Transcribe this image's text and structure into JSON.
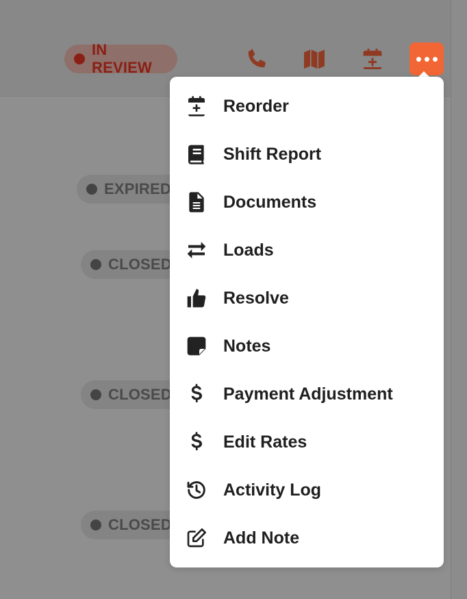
{
  "header": {
    "status_badge": "IN REVIEW",
    "actions": [
      {
        "name": "phone-icon"
      },
      {
        "name": "map-icon"
      },
      {
        "name": "calendar-plus-icon"
      },
      {
        "name": "more-icon"
      }
    ]
  },
  "rows": [
    {
      "status": "EXPIRED"
    },
    {
      "status": "CLOSED"
    },
    {
      "status": "CLOSED"
    },
    {
      "status": "CLOSED"
    }
  ],
  "menu": {
    "items": [
      {
        "label": "Reorder",
        "icon": "calendar-plus-icon"
      },
      {
        "label": "Shift Report",
        "icon": "book-icon"
      },
      {
        "label": "Documents",
        "icon": "file-lines-icon"
      },
      {
        "label": "Loads",
        "icon": "arrows-exchange-icon"
      },
      {
        "label": "Resolve",
        "icon": "thumbs-up-icon"
      },
      {
        "label": "Notes",
        "icon": "sticky-note-icon"
      },
      {
        "label": "Payment Adjustment",
        "icon": "dollar-icon"
      },
      {
        "label": "Edit Rates",
        "icon": "dollar-icon"
      },
      {
        "label": "Activity Log",
        "icon": "history-icon"
      },
      {
        "label": "Add Note",
        "icon": "edit-icon"
      }
    ]
  },
  "colors": {
    "accent": "#f26534",
    "review": "#8a1f15",
    "overlay": "#8f8f8f"
  }
}
